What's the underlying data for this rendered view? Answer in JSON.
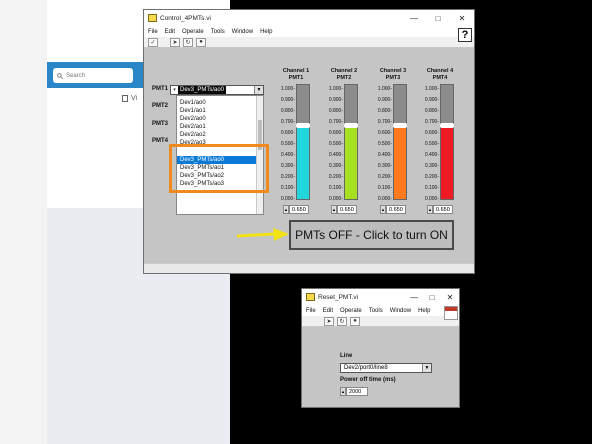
{
  "background": {
    "search_placeholder": "Search",
    "vi_label": "Vi"
  },
  "main_window": {
    "title": "Control_4PMTs.vi",
    "menu": [
      "File",
      "Edit",
      "Operate",
      "Tools",
      "Window",
      "Help"
    ],
    "help_symbol": "?",
    "pmt_labels": [
      "PMT1",
      "PMT2",
      "PMT3",
      "PMT4"
    ],
    "dropdown": {
      "selected_value": "Dev3_PMTs/ao0",
      "items": [
        "Dev1/ao0",
        "Dev1/ao1",
        "Dev2/ao0",
        "Dev2/ao1",
        "Dev2/ao2",
        "Dev2/ao3",
        "Dev3_PMTs/ao0",
        "Dev3_PMTs/ao1",
        "Dev3_PMTs/ao2",
        "Dev3_PMTs/ao3"
      ],
      "highlighted_index": 6
    },
    "scale_ticks": [
      "1.000-",
      "0.900-",
      "0.800-",
      "0.700-",
      "0.600-",
      "0.500-",
      "0.400-",
      "0.300-",
      "0.200-",
      "0.100-",
      "0.000-"
    ],
    "channels": [
      {
        "title": "Channel 1",
        "subtitle": "PMT1",
        "level": 0.65,
        "color": "#21d6dd",
        "value": "0.650"
      },
      {
        "title": "Channel 2",
        "subtitle": "PMT2",
        "level": 0.65,
        "color": "#a6e020",
        "value": "0.650"
      },
      {
        "title": "Channel 3",
        "subtitle": "PMT3",
        "level": 0.65,
        "color": "#ff7a1c",
        "value": "0.650"
      },
      {
        "title": "Channel 4",
        "subtitle": "PMT4",
        "level": 0.65,
        "color": "#ee1b24",
        "value": "0.650"
      }
    ],
    "toggle_button_label": "PMTs OFF - Click to turn ON",
    "annotation_arrow_color": "#f2e218",
    "annotation_box_color": "#f08a1e"
  },
  "reset_window": {
    "title": "Reset_PMT.vi",
    "menu": [
      "File",
      "Edit",
      "Operate",
      "Tools",
      "Window",
      "Help"
    ],
    "line_label": "Line",
    "line_value": "Dev2/port0/line8",
    "power_off_label": "Power off time (ms)",
    "power_off_value": "2000"
  }
}
